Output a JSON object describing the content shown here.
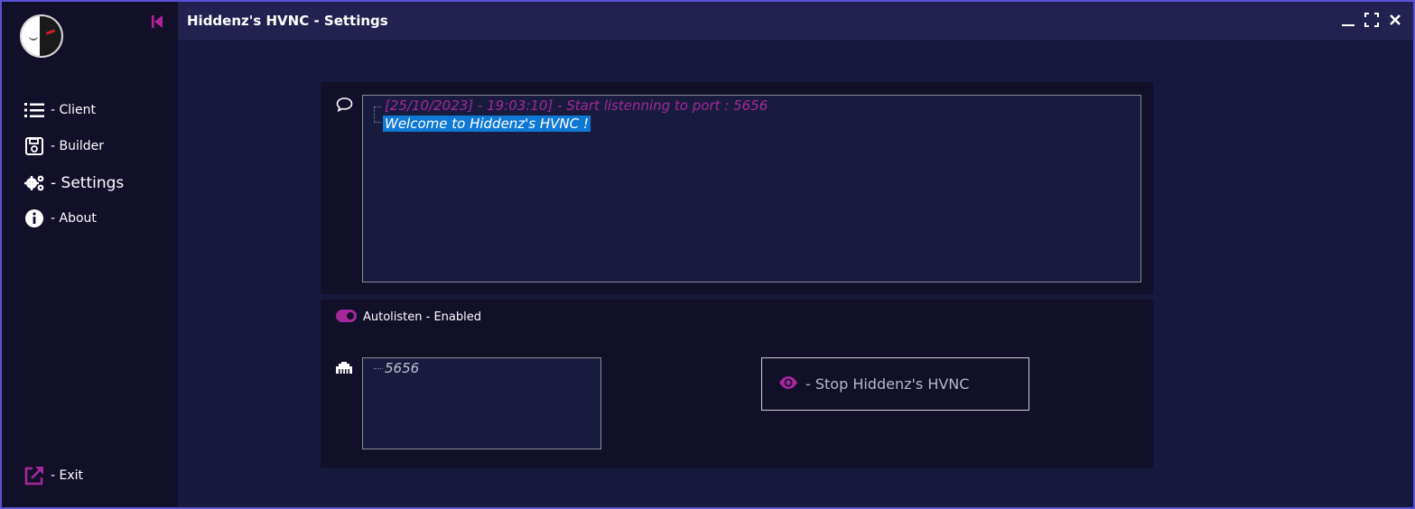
{
  "window": {
    "title": "Hiddenz's HVNC - Settings",
    "accent": "#a4279c",
    "border_color": "#5a52d6"
  },
  "sidebar": {
    "collapse_icon": "collapse-left-icon",
    "items": [
      {
        "label": "- Client",
        "icon": "list-icon"
      },
      {
        "label": "- Builder",
        "icon": "floppy-disk-icon"
      },
      {
        "label": "- Settings",
        "icon": "gears-icon",
        "active": true
      },
      {
        "label": "- About",
        "icon": "info-circle-icon"
      }
    ],
    "exit": {
      "label": "- Exit",
      "icon": "external-link-icon"
    }
  },
  "log": {
    "icon": "chat-bubble-icon",
    "lines": [
      "[25/10/2023] - 19:03:10] - Start listenning to port : 5656",
      "Welcome to Hiddenz's HVNC !"
    ]
  },
  "settings": {
    "autolisten_label": "Autolisten - Enabled",
    "autolisten_enabled": true,
    "port_icon": "network-port-icon",
    "port_value": "5656",
    "stop_button_label": "- Stop Hiddenz's HVNC",
    "stop_button_icon": "eye-icon"
  }
}
